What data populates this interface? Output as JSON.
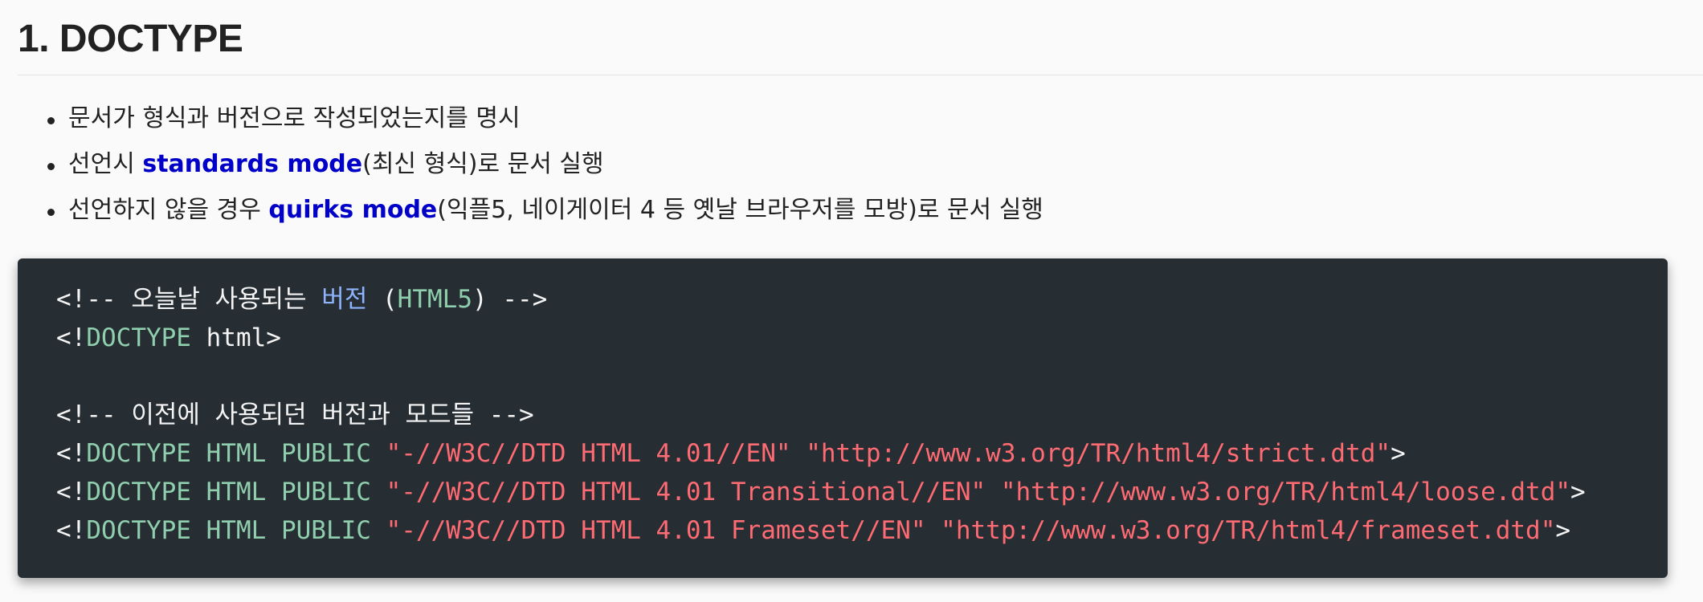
{
  "heading": "1. DOCTYPE",
  "bullets": [
    {
      "text": "문서가 형식과 버전으로 작성되었는지를 명시"
    },
    {
      "before": "선언시 ",
      "keyword": "standards mode",
      "after": "(최신 형식)로 문서 실행"
    },
    {
      "before": "선언하지 않을 경우 ",
      "keyword": "quirks mode",
      "after": "(익플5, 네이게이터 4 등 옛날 브라우저를 모방)로 문서 실행"
    }
  ],
  "code": {
    "line1": {
      "open": "<!-- 오늘날 사용되는 ",
      "word": "버전",
      "space": " (",
      "html5": "HTML5",
      "close": ") -->"
    },
    "line2": {
      "lt": "<!",
      "doctype": "DOCTYPE",
      "rest": " html>"
    },
    "line4": "<!-- 이전에 사용되던 버전과 모드들 -->",
    "doctype_lines": [
      {
        "lt": "<!",
        "decl": "DOCTYPE HTML PUBLIC",
        "sp": " ",
        "fpi": "\"-//W3C//DTD HTML 4.01//EN\"",
        "sp2": " ",
        "url": "\"http://www.w3.org/TR/html4/strict.dtd\"",
        "gt": ">"
      },
      {
        "lt": "<!",
        "decl": "DOCTYPE HTML PUBLIC",
        "sp": " ",
        "fpi": "\"-//W3C//DTD HTML 4.01 Transitional//EN\"",
        "sp2": " ",
        "url": "\"http://www.w3.org/TR/html4/loose.dtd\"",
        "gt": ">"
      },
      {
        "lt": "<!",
        "decl": "DOCTYPE HTML PUBLIC",
        "sp": " ",
        "fpi": "\"-//W3C//DTD HTML 4.01 Frameset//EN\"",
        "sp2": " ",
        "url": "\"http://www.w3.org/TR/html4/frameset.dtd\"",
        "gt": ">"
      }
    ]
  },
  "colors": {
    "keyword": "#0000c8",
    "code_background": "#262d33",
    "code_teal": "#8fcfae",
    "code_red": "#ff6b73",
    "code_blue": "#8fb4ff"
  }
}
